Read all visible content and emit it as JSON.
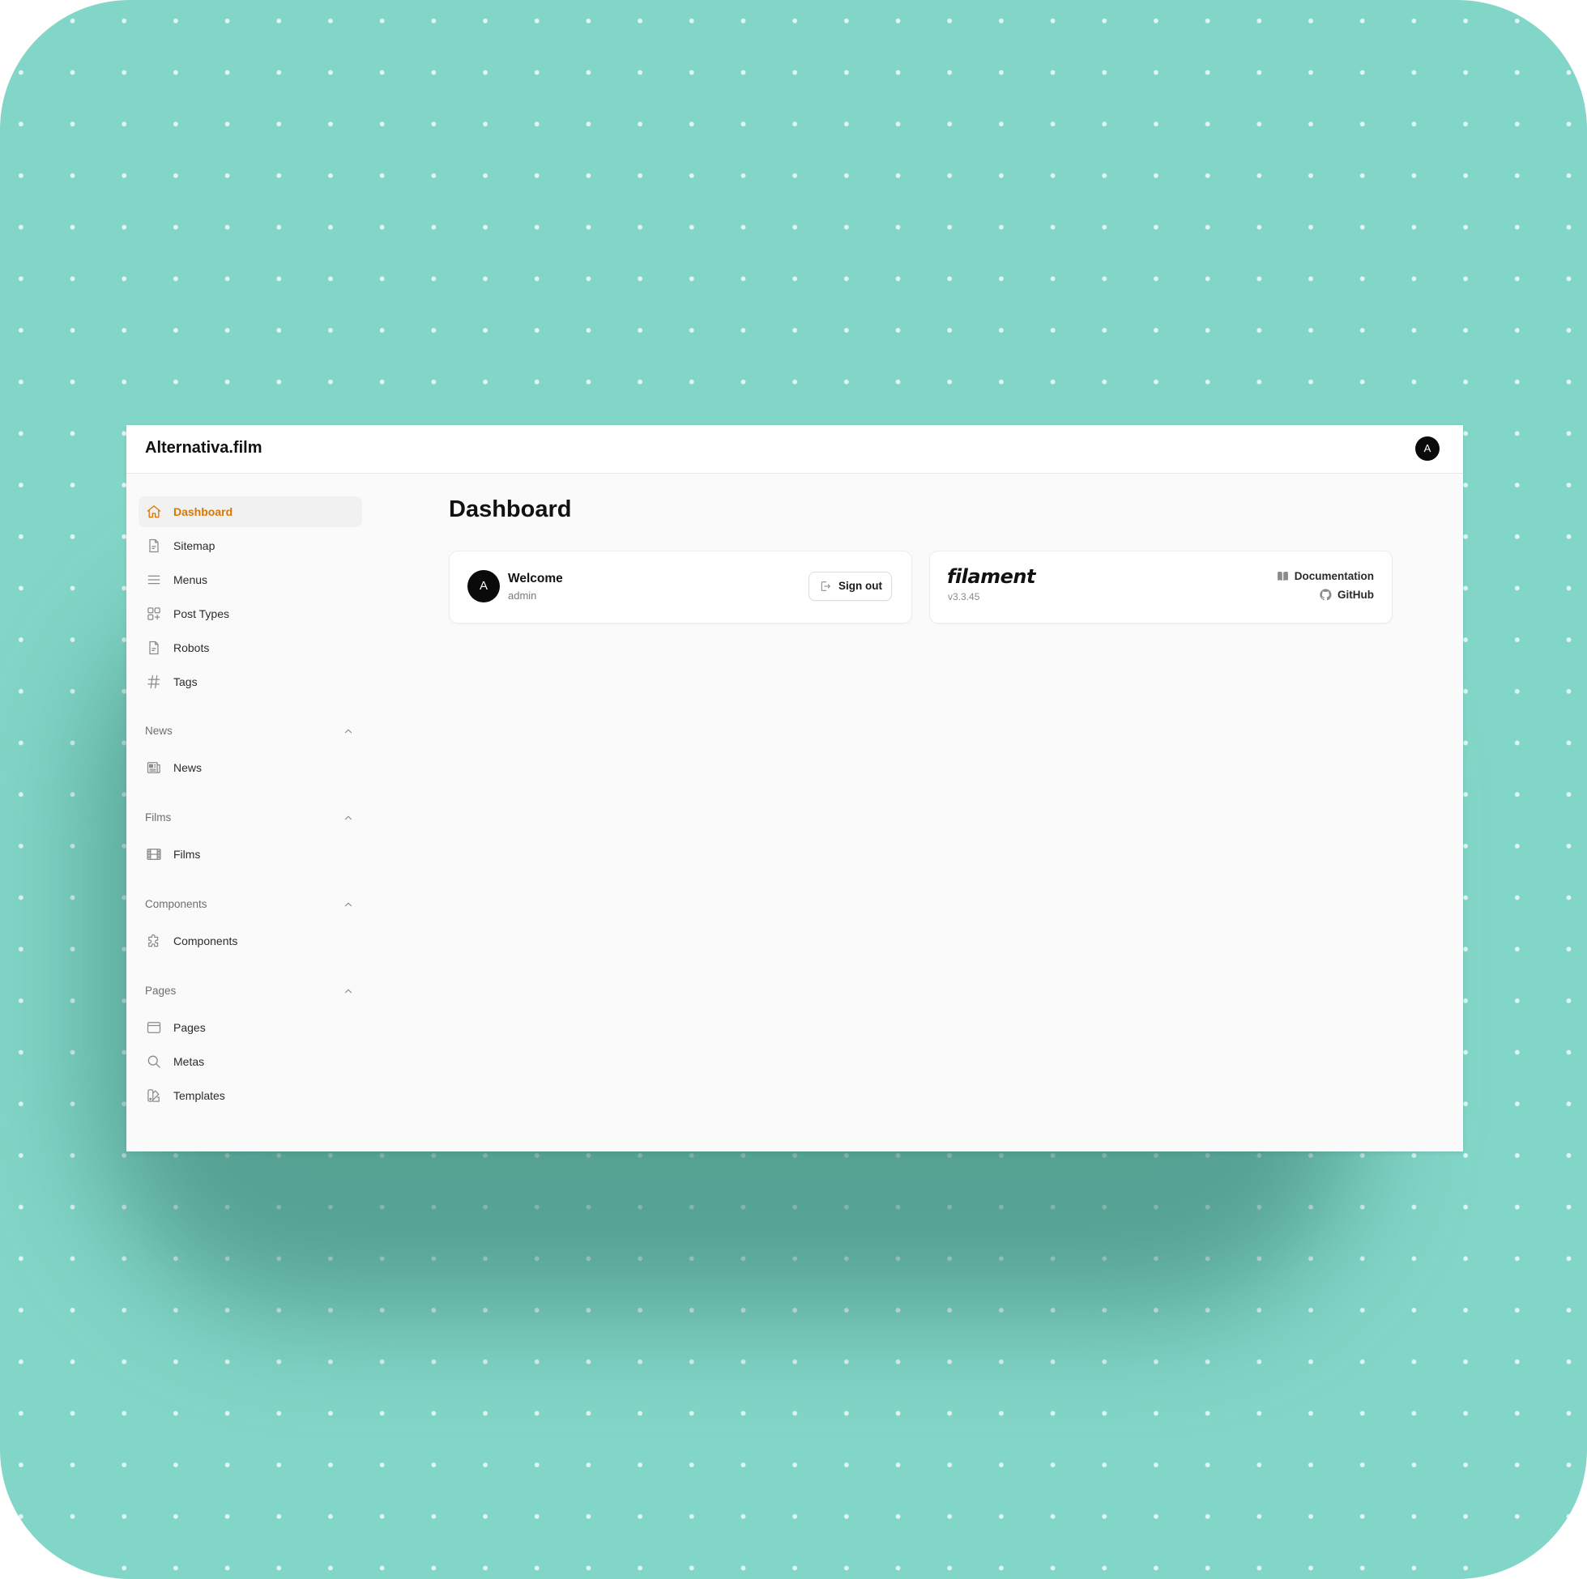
{
  "app": {
    "brand": "Alternativa.film",
    "user_initial": "A",
    "accent": "#d97706"
  },
  "sidebar": {
    "primary": [
      {
        "label": "Dashboard",
        "icon": "home-icon",
        "active": true
      },
      {
        "label": "Sitemap",
        "icon": "document-icon"
      },
      {
        "label": "Menus",
        "icon": "bars-icon"
      },
      {
        "label": "Post Types",
        "icon": "squares-plus-icon"
      },
      {
        "label": "Robots",
        "icon": "document-icon"
      },
      {
        "label": "Tags",
        "icon": "hashtag-icon"
      }
    ],
    "groups": [
      {
        "label": "News",
        "items": [
          {
            "label": "News",
            "icon": "newspaper-icon"
          }
        ]
      },
      {
        "label": "Films",
        "items": [
          {
            "label": "Films",
            "icon": "film-icon"
          }
        ]
      },
      {
        "label": "Components",
        "items": [
          {
            "label": "Components",
            "icon": "puzzle-icon"
          }
        ]
      },
      {
        "label": "Pages",
        "items": [
          {
            "label": "Pages",
            "icon": "window-icon"
          },
          {
            "label": "Metas",
            "icon": "magnifier-icon"
          },
          {
            "label": "Templates",
            "icon": "swatch-icon"
          }
        ]
      }
    ]
  },
  "main": {
    "title": "Dashboard",
    "account_widget": {
      "initial": "A",
      "title": "Welcome",
      "subtitle": "admin",
      "signout_label": "Sign out"
    },
    "filament_widget": {
      "logo": "filament",
      "version": "v3.3.45",
      "docs_label": "Documentation",
      "github_label": "GitHub"
    }
  }
}
